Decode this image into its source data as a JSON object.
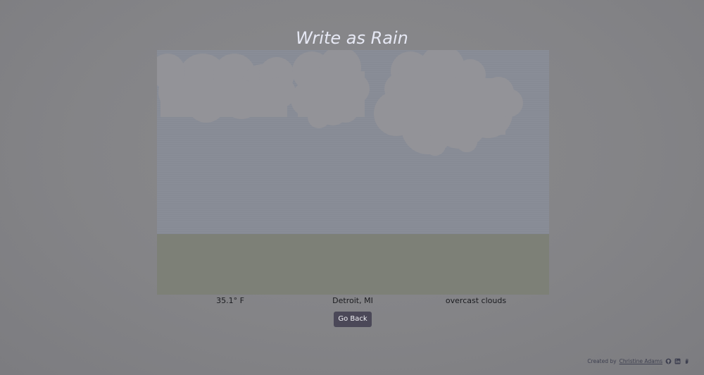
{
  "app": {
    "title": "Write as Rain"
  },
  "weather": {
    "temperature": "35.1° F",
    "location": "Detroit, MI",
    "description": "overcast clouds"
  },
  "actions": {
    "go_back_label": "Go Back"
  },
  "footer": {
    "created_by_label": "Created by",
    "author_name": "Christine Adams",
    "icons": [
      "github-icon",
      "linkedin-icon",
      "hand-icon"
    ]
  },
  "colors": {
    "sky": "#888c96",
    "ground": "#7d8077",
    "cloud": "#939398",
    "button_bg": "#4b4858",
    "title_text": "#e6e8f4"
  }
}
